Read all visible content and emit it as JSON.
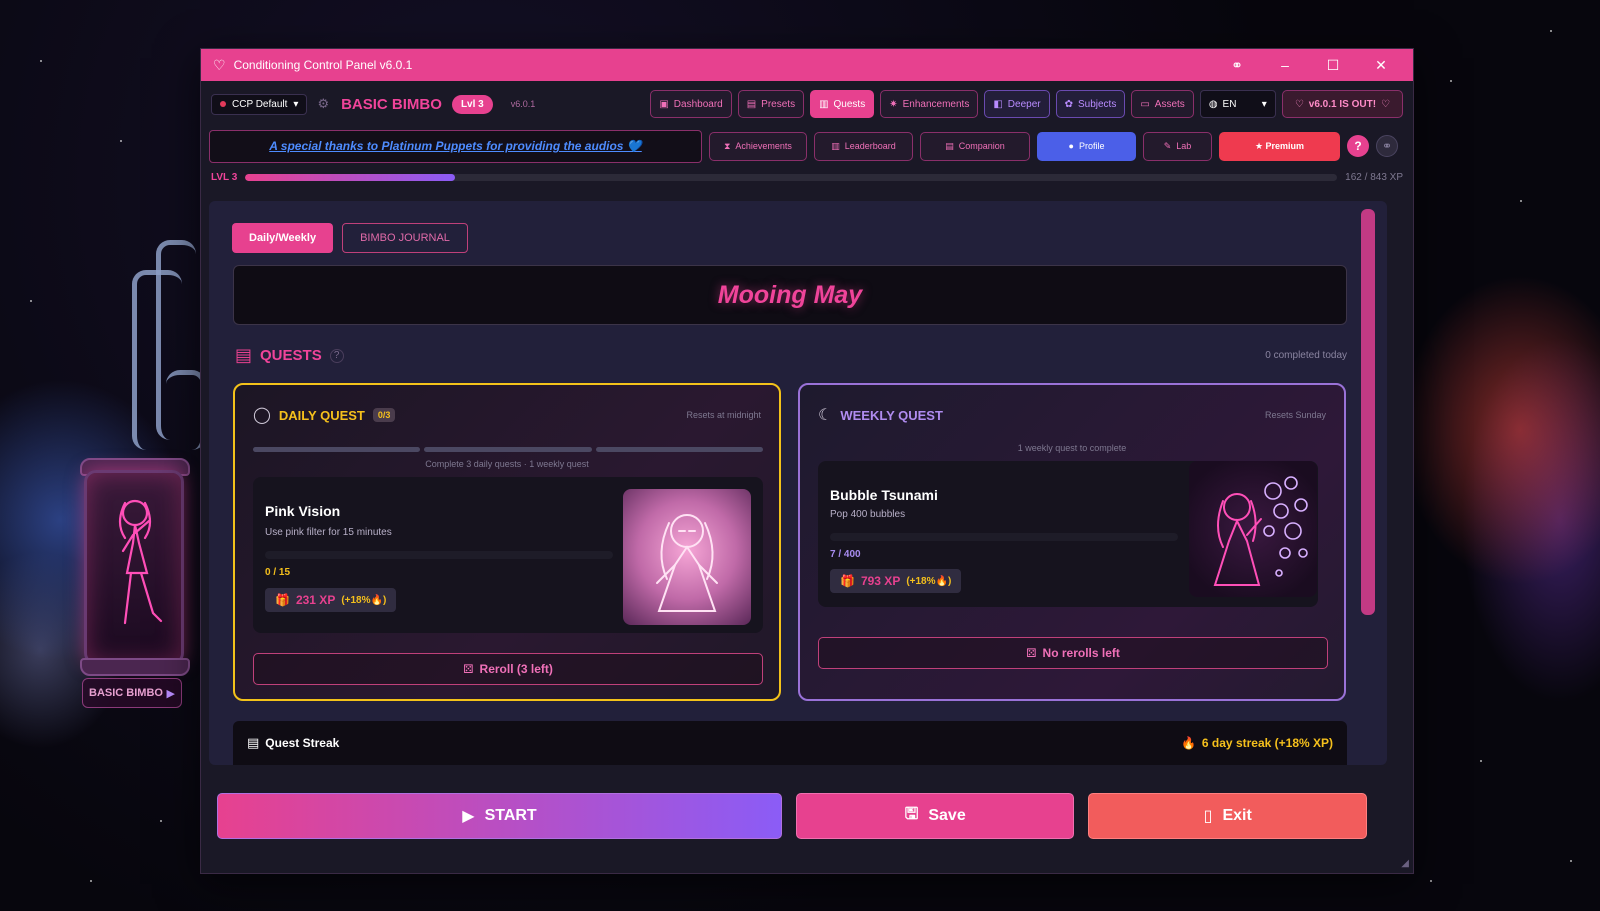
{
  "window": {
    "title": "Conditioning Control Panel v6.0.1"
  },
  "header": {
    "profile_select": "CCP Default",
    "rank_name": "BASIC BIMBO",
    "level_badge": "Lvl 3",
    "version": "v6.0.1",
    "nav": [
      {
        "label": "Dashboard",
        "icon": "dashboard-icon"
      },
      {
        "label": "Presets",
        "icon": "presets-icon"
      },
      {
        "label": "Quests",
        "icon": "quests-icon",
        "active": true
      },
      {
        "label": "Enhancements",
        "icon": "sparkle-icon"
      },
      {
        "label": "Deeper",
        "icon": "deeper-icon"
      },
      {
        "label": "Subjects",
        "icon": "subjects-icon"
      },
      {
        "label": "Assets",
        "icon": "folder-icon"
      }
    ],
    "language": "EN",
    "update_notice": "v6.0.1 IS OUT!"
  },
  "subnav": {
    "banner_text": "A special thanks to Platinum Puppets for providing the audios 💙",
    "buttons": [
      {
        "label": "Achievements"
      },
      {
        "label": "Leaderboard"
      },
      {
        "label": "Companion"
      },
      {
        "label": "Profile",
        "active": true
      },
      {
        "label": "Lab"
      },
      {
        "label": "★ Premium"
      }
    ],
    "help_label": "?"
  },
  "xp": {
    "level_label": "LVL 3",
    "progress_fraction": 0.192,
    "progress_text": "162 / 843 XP"
  },
  "tabs": [
    {
      "label": "Daily/Weekly",
      "active": true
    },
    {
      "label": "BIMBO JOURNAL",
      "active": false
    }
  ],
  "event_title": "Mooing May",
  "quests": {
    "heading": "QUESTS",
    "help": "?",
    "completed_today": "0 completed today",
    "daily": {
      "title": "DAILY QUEST",
      "count": "0/3",
      "reset_note": "Resets at midnight",
      "caption": "Complete 3 daily quests · 1 weekly quest",
      "name": "Pink Vision",
      "description": "Use pink filter for 15 minutes",
      "progress_text": "0 / 15",
      "progress_fraction": 0,
      "xp": "231 XP",
      "bonus": "(+18%🔥)",
      "reroll": "Reroll (3 left)"
    },
    "weekly": {
      "title": "WEEKLY QUEST",
      "reset_note": "Resets Sunday",
      "caption": "1 weekly quest to complete",
      "name": "Bubble Tsunami",
      "description": "Pop 400 bubbles",
      "progress_text": "7 / 400",
      "progress_fraction": 0.0175,
      "xp": "793 XP",
      "bonus": "(+18%🔥)",
      "reroll": "No rerolls left"
    }
  },
  "streak": {
    "label": "Quest Streak",
    "value": "6 day streak (+18% XP)"
  },
  "actions": {
    "start": "START",
    "save": "Save",
    "exit": "Exit"
  },
  "side_pod": {
    "label": "BASIC BIMBO"
  }
}
